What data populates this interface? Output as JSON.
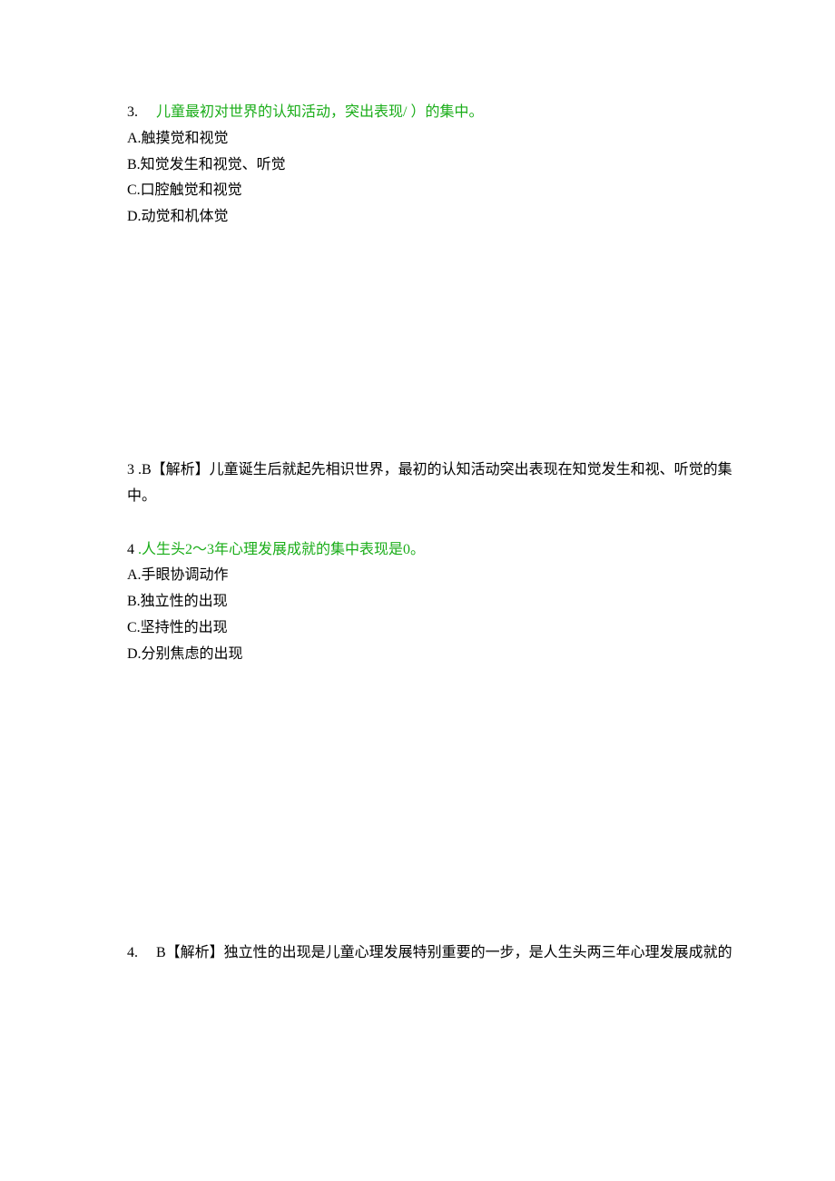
{
  "q3": {
    "number": "3.",
    "text_part1": "儿童最初对世界的认知活动，突出表现/",
    "blank": "       ",
    "text_part2": "）的集中。",
    "options": {
      "A": "A.触摸觉和视觉",
      "B": "B.知觉发生和视觉、听觉",
      "C": "C.口腔触觉和视觉",
      "D": "D.动觉和机体觉"
    }
  },
  "ans3": {
    "num": "3",
    "text": " .B【解析】儿童诞生后就起先相识世界，最初的认知活动突出表现在知觉发生和视、听觉的集中。"
  },
  "q4": {
    "number": "4",
    "text": " .人生头2～3年心理发展成就的集中表现是0。",
    "options": {
      "A": "A.手眼协调动作",
      "B": "B.独立性的出现",
      "C": "C.坚持性的出现",
      "D": "D.分别焦虑的出现"
    }
  },
  "ans4": {
    "num": "4.",
    "text": "B【解析】独立性的出现是儿童心理发展特别重要的一步，是人生头两三年心理发展成就的"
  }
}
